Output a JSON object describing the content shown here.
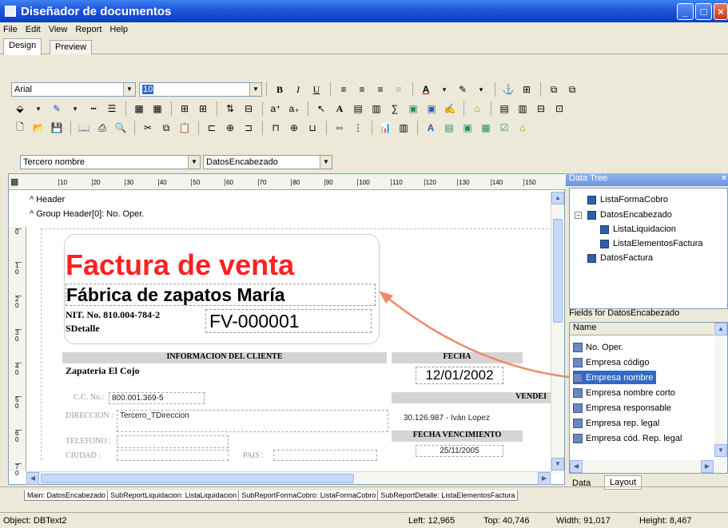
{
  "window": {
    "title": "Diseñador de documentos"
  },
  "menu": [
    "File",
    "Edit",
    "View",
    "Report",
    "Help"
  ],
  "tabs": {
    "design": "Design",
    "preview": "Preview"
  },
  "toolbar": {
    "font_name": "Arial",
    "font_size": "10",
    "bold": "B",
    "italic": "I",
    "underline": "U",
    "group_combo": "Tercero nombre",
    "source_combo": "DatosEncabezado"
  },
  "ruler": {
    "marks": [
      "10",
      "20",
      "30",
      "40",
      "50",
      "60",
      "70",
      "80",
      "90",
      "100",
      "110",
      "120",
      "130",
      "140",
      "150"
    ],
    "left_marks": [
      "0",
      "1 0",
      "2 0",
      "3 0",
      "4 0",
      "5 0",
      "6 0",
      "7 0"
    ]
  },
  "bands": {
    "header": "Header",
    "group_header": "Group Header[0]: No. Oper."
  },
  "report": {
    "title": "Factura de venta",
    "company": "Fábrica de zapatos María",
    "nit": "NIT. No. 810.004-784-2",
    "detail": "SDetalle",
    "invoice_no": "FV-000001",
    "client_header": "INFORMACION DEL CLIENTE",
    "date_header": "FECHA",
    "client_name": "Zapateria El Cojo",
    "date_value": "12/01/2002",
    "cc_label": "C.C. No.:",
    "cc_value": "800.001.369-5",
    "seller_header": "VENDEI",
    "address_label": "DIRECCION :",
    "address_value": "Tercero_TDireccion",
    "seller_value": "30.126.987 - Iván Lopez",
    "due_header": "FECHA VENCIMIENTO",
    "phone_label": "TELEFONO :",
    "due_value": "25/11/2005",
    "city_label": "CIUDAD :",
    "country_label": "PAIS :"
  },
  "data_tree": {
    "title": "Data Tree",
    "nodes": [
      "ListaFormaCobro",
      "DatosEncabezado",
      "ListaLiquidacion",
      "ListaElementosFactura",
      "DatosFactura"
    ]
  },
  "fields": {
    "title": "Fields for DatosEncabezado",
    "column": "Name",
    "items": [
      "No. Oper.",
      "Empresa código",
      "Empresa nombre",
      "Empresa nombre corto",
      "Empresa responsable",
      "Empresa rep. legal",
      "Empresa cód. Rep. legal"
    ],
    "selected": "Empresa nombre"
  },
  "panel_tabs": {
    "data": "Data",
    "layout": "Layout"
  },
  "bottom_tabs": [
    "Main: DatosEncabezado",
    "SubReportLiquidacion: ListaLiquidacion",
    "SubReportFormaCobro: ListaFormaCobro",
    "SubReportDetalle: ListaElementosFactura"
  ],
  "status": {
    "object": "Object: DBText2",
    "left": "Left: 12,965",
    "top": "Top: 40,746",
    "width": "Width: 91,017",
    "height": "Height: 8,467"
  },
  "colors": {
    "title_red": "#ff2020",
    "selection": "#316ac5",
    "arrow": "#f08a6a"
  }
}
